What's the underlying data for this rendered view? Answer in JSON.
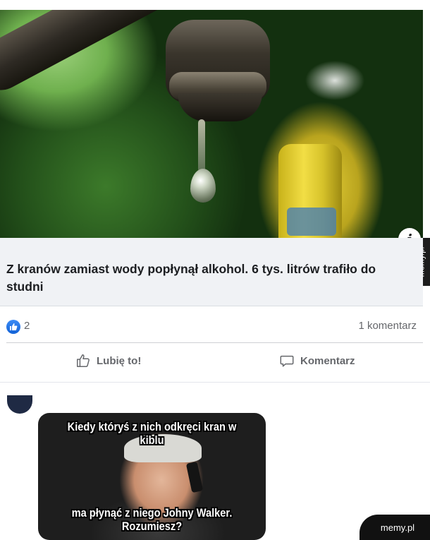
{
  "post": {
    "link_title": "Z kranów zamiast wody popłynął alkohol. 6 tys. litrów trafiło do studni",
    "info_badge": "i",
    "reactions": {
      "like_count": "2",
      "comments": "1 komentarz"
    },
    "actions": {
      "like_label": "Lubię to!",
      "comment_label": "Komentarz"
    }
  },
  "comment": {
    "meme": {
      "top_text": "Kiedy któryś z nich odkręci kran w kiblu",
      "bottom_text": "ma płynąć z niego Johny Walker. Rozumiesz?"
    }
  },
  "watermark": {
    "side": "memy.pl",
    "corner": "memy.pl"
  },
  "colors": {
    "like_blue": "#1877f2",
    "text_secondary": "#65676b",
    "link_bg": "#f0f2f5"
  }
}
